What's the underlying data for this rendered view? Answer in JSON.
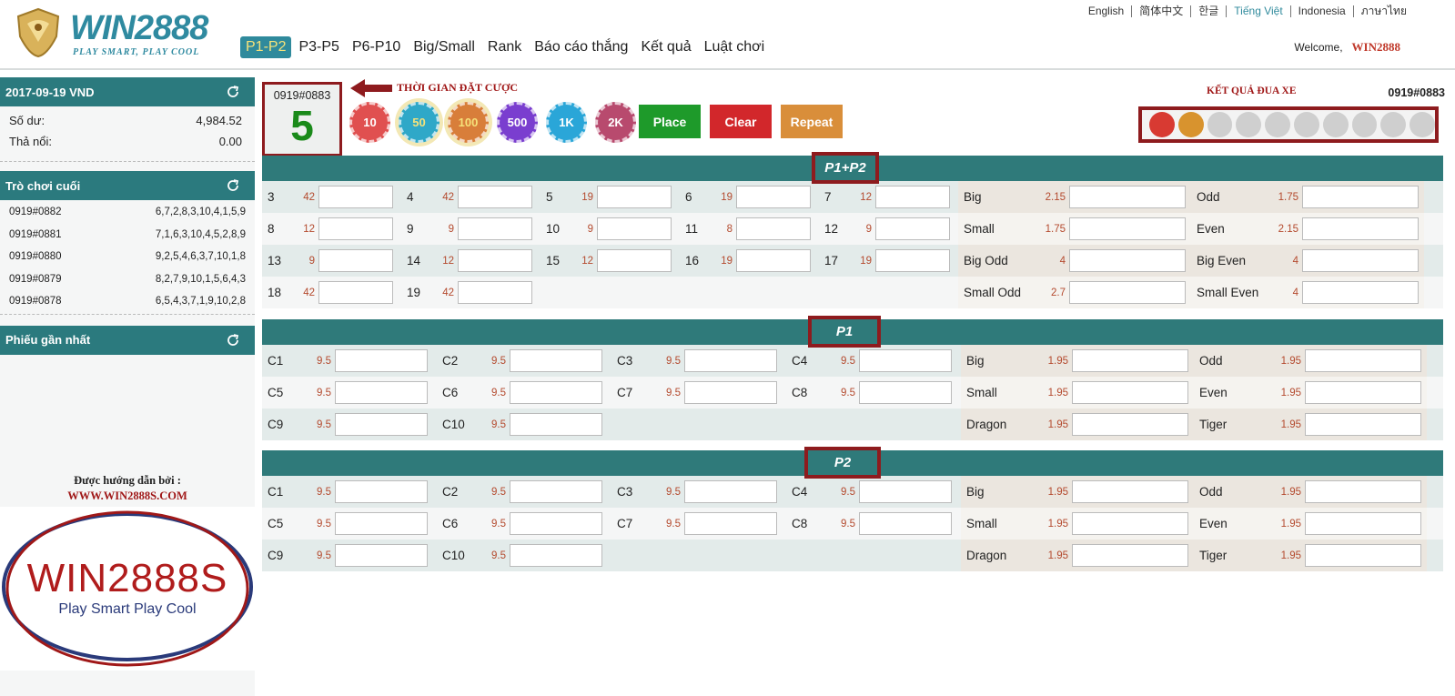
{
  "header": {
    "logo_text": "WIN2888",
    "logo_sub": "PLAY SMART, PLAY COOL",
    "nav": [
      "P1-P2",
      "P3-P5",
      "P6-P10",
      "Big/Small",
      "Rank",
      "Báo cáo thắng",
      "Kết quả",
      "Luật chơi"
    ],
    "languages": [
      "English",
      "简体中文",
      "한글",
      "Tiếng Việt",
      "Indonesia",
      "ภาษาไทย"
    ],
    "welcome_label": "Welcome,",
    "username": "WIN2888"
  },
  "sidebar": {
    "balance_title": "2017-09-19 VND",
    "balance_label": "Số dư:",
    "balance_value": "4,984.52",
    "float_label": "Thả nổi:",
    "float_value": "0.00",
    "last_games_title": "Trò chơi cuối",
    "last_games": [
      {
        "id": "0919#0882",
        "result": "6,7,2,8,3,10,4,1,5,9"
      },
      {
        "id": "0919#0881",
        "result": "7,1,6,3,10,4,5,2,8,9"
      },
      {
        "id": "0919#0880",
        "result": "9,2,5,4,6,3,7,10,1,8"
      },
      {
        "id": "0919#0879",
        "result": "8,2,7,9,10,1,5,6,4,3"
      },
      {
        "id": "0919#0878",
        "result": "6,5,4,3,7,1,9,10,2,8"
      }
    ],
    "recent_tickets_title": "Phiếu gần nhất",
    "guide_text": "Được hướng dẫn bởi :",
    "guide_url": "WWW.WIN2888S.COM",
    "logo_big": "WIN2888S",
    "logo_big_sub": "Play Smart Play Cool"
  },
  "betting": {
    "draw_id": "0919#0883",
    "countdown": "5",
    "bet_time_label": "THỜI GIAN ĐẶT CƯỢC",
    "chips": [
      {
        "label": "10",
        "color": "#e05050",
        "selected": false
      },
      {
        "label": "50",
        "color": "#2fa8c8",
        "selected": true
      },
      {
        "label": "100",
        "color": "#d87e3a",
        "selected": true
      },
      {
        "label": "500",
        "color": "#7a3ecf",
        "selected": false
      },
      {
        "label": "1K",
        "color": "#2aa6d8",
        "selected": false
      },
      {
        "label": "2K",
        "color": "#b84a6e",
        "selected": false
      }
    ],
    "place_label": "Place",
    "clear_label": "Clear",
    "repeat_label": "Repeat",
    "results_label": "KẾT QUẢ ĐUA XE",
    "results_id": "0919#0883",
    "result_balls": [
      "#d83a32",
      "#d8932e",
      "#cfcfcf",
      "#cfcfcf",
      "#cfcfcf",
      "#cfcfcf",
      "#cfcfcf",
      "#cfcfcf",
      "#cfcfcf",
      "#cfcfcf"
    ]
  },
  "sections": [
    {
      "title": "P1+P2",
      "rows": [
        [
          {
            "l": "3",
            "o": "42"
          },
          {
            "l": "4",
            "o": "42"
          },
          {
            "l": "5",
            "o": "19"
          },
          {
            "l": "6",
            "o": "19"
          },
          {
            "l": "7",
            "o": "12"
          },
          {
            "l": "Big",
            "o": "2.15"
          },
          {
            "l": "Odd",
            "o": "1.75"
          }
        ],
        [
          {
            "l": "8",
            "o": "12"
          },
          {
            "l": "9",
            "o": "9"
          },
          {
            "l": "10",
            "o": "9"
          },
          {
            "l": "11",
            "o": "8"
          },
          {
            "l": "12",
            "o": "9"
          },
          {
            "l": "Small",
            "o": "1.75"
          },
          {
            "l": "Even",
            "o": "2.15"
          }
        ],
        [
          {
            "l": "13",
            "o": "9"
          },
          {
            "l": "14",
            "o": "12"
          },
          {
            "l": "15",
            "o": "12"
          },
          {
            "l": "16",
            "o": "19"
          },
          {
            "l": "17",
            "o": "19"
          },
          {
            "l": "Big Odd",
            "o": "4"
          },
          {
            "l": "Big Even",
            "o": "4"
          }
        ],
        [
          {
            "l": "18",
            "o": "42"
          },
          {
            "l": "19",
            "o": "42"
          },
          null,
          null,
          null,
          {
            "l": "Small Odd",
            "o": "2.7"
          },
          {
            "l": "Small Even",
            "o": "4"
          }
        ]
      ]
    },
    {
      "title": "P1",
      "rows": [
        [
          {
            "l": "C1",
            "o": "9.5"
          },
          {
            "l": "C2",
            "o": "9.5"
          },
          {
            "l": "C3",
            "o": "9.5"
          },
          {
            "l": "C4",
            "o": "9.5"
          },
          {
            "l": "Big",
            "o": "1.95"
          },
          {
            "l": "Odd",
            "o": "1.95"
          }
        ],
        [
          {
            "l": "C5",
            "o": "9.5"
          },
          {
            "l": "C6",
            "o": "9.5"
          },
          {
            "l": "C7",
            "o": "9.5"
          },
          {
            "l": "C8",
            "o": "9.5"
          },
          {
            "l": "Small",
            "o": "1.95"
          },
          {
            "l": "Even",
            "o": "1.95"
          }
        ],
        [
          {
            "l": "C9",
            "o": "9.5"
          },
          {
            "l": "C10",
            "o": "9.5"
          },
          null,
          null,
          {
            "l": "Dragon",
            "o": "1.95"
          },
          {
            "l": "Tiger",
            "o": "1.95"
          }
        ]
      ]
    },
    {
      "title": "P2",
      "rows": [
        [
          {
            "l": "C1",
            "o": "9.5"
          },
          {
            "l": "C2",
            "o": "9.5"
          },
          {
            "l": "C3",
            "o": "9.5"
          },
          {
            "l": "C4",
            "o": "9.5"
          },
          {
            "l": "Big",
            "o": "1.95"
          },
          {
            "l": "Odd",
            "o": "1.95"
          }
        ],
        [
          {
            "l": "C5",
            "o": "9.5"
          },
          {
            "l": "C6",
            "o": "9.5"
          },
          {
            "l": "C7",
            "o": "9.5"
          },
          {
            "l": "C8",
            "o": "9.5"
          },
          {
            "l": "Small",
            "o": "1.95"
          },
          {
            "l": "Even",
            "o": "1.95"
          }
        ],
        [
          {
            "l": "C9",
            "o": "9.5"
          },
          {
            "l": "C10",
            "o": "9.5"
          },
          null,
          null,
          {
            "l": "Dragon",
            "o": "1.95"
          },
          {
            "l": "Tiger",
            "o": "1.95"
          }
        ]
      ]
    }
  ]
}
